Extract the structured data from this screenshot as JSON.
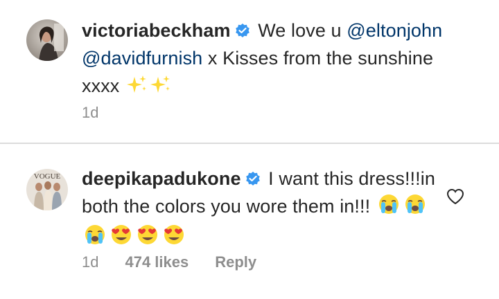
{
  "comments": [
    {
      "username": "victoriabeckham",
      "verified": true,
      "text_part1": " We love u ",
      "mention1": "@eltonjohn",
      "mention2": "@davidfurnish",
      "text_part2": " x Kisses from the sunshine xxxx ",
      "emojis": [
        "sparkles-emoji",
        "sparkles-emoji"
      ],
      "time": "1d"
    },
    {
      "username": "deepikapadukone",
      "verified": true,
      "text": " I want this dress!!!in both the colors you wore them in!!! ",
      "emojis": [
        "loudly-crying-face-emoji",
        "loudly-crying-face-emoji",
        "loudly-crying-face-emoji",
        "heart-eyes-emoji",
        "heart-eyes-emoji",
        "heart-eyes-emoji"
      ],
      "avatar_text": "VOGUE",
      "time": "1d",
      "likes": "474 likes",
      "reply": "Reply",
      "like_icon": "heart-outline-icon"
    }
  ],
  "colors": {
    "text": "#262626",
    "mention": "#003569",
    "meta": "#8e8e8e",
    "verified": "#3897f0",
    "divider": "#dbdbdb"
  }
}
